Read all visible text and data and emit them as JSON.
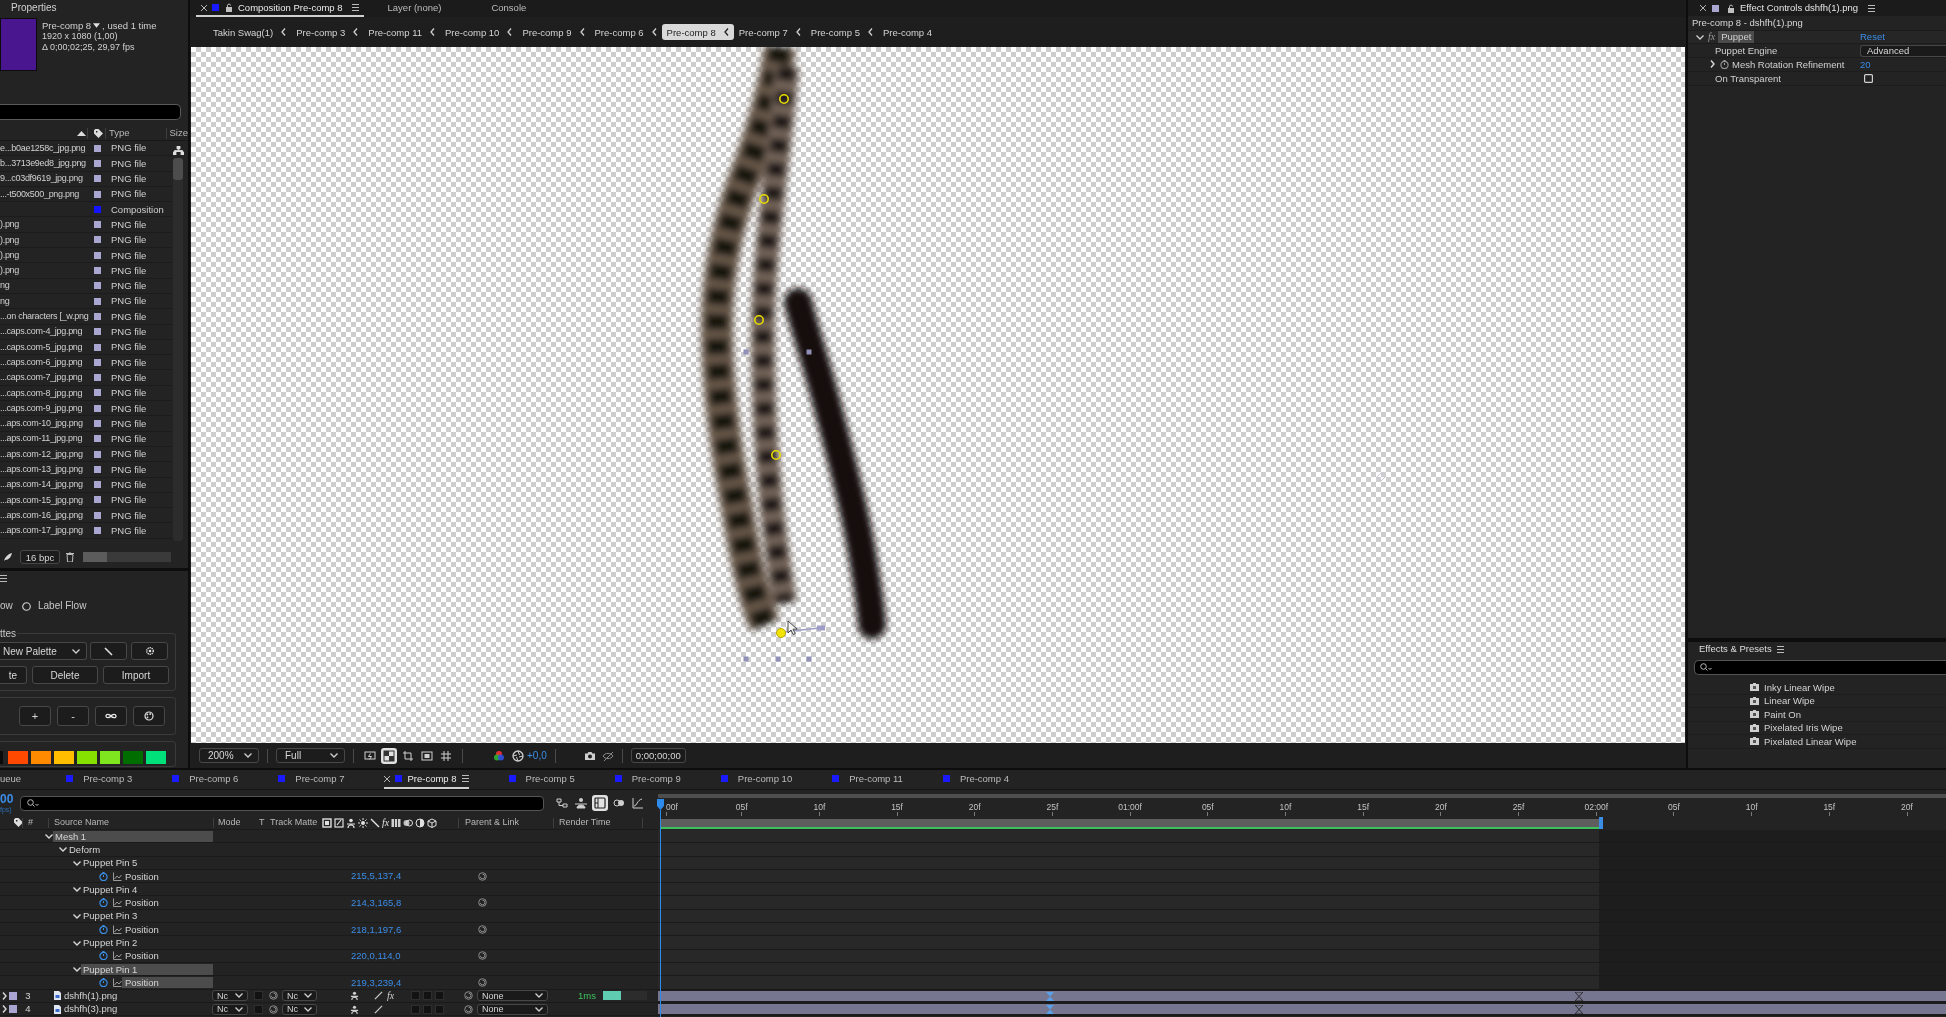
{
  "project_panel": {
    "tab": "Properties",
    "comp_name": "Pre-comp 8",
    "usage": ", used 1 time",
    "dimensions": "1920 x 1080 (1,00)",
    "duration": "Δ 0;00;02;25, 29,97 fps",
    "columns": [
      "Type",
      "Size"
    ],
    "items": [
      {
        "name": "e...b0ae1258c_jpg.png",
        "color": "#a9a7d1",
        "type": "PNG file"
      },
      {
        "name": "b...3713e9ed8_jpg.png",
        "color": "#a9a7d1",
        "type": "PNG file"
      },
      {
        "name": "9...c03df9619_jpg.png",
        "color": "#a9a7d1",
        "type": "PNG file"
      },
      {
        "name": "...-t500x500_png.png",
        "color": "#a9a7d1",
        "type": "PNG file"
      },
      {
        "color": "#1414ff",
        "type": "Composition"
      },
      {
        "name": ").png",
        "color": "#a9a7d1",
        "type": "PNG file"
      },
      {
        "name": ").png",
        "color": "#a9a7d1",
        "type": "PNG file"
      },
      {
        "name": ").png",
        "color": "#a9a7d1",
        "type": "PNG file"
      },
      {
        "name": ").png",
        "color": "#a9a7d1",
        "type": "PNG file"
      },
      {
        "name": "ng",
        "color": "#a9a7d1",
        "type": "PNG file"
      },
      {
        "name": "ng",
        "color": "#a9a7d1",
        "type": "PNG file"
      },
      {
        "name": "...on characters [_w.png",
        "color": "#a9a7d1",
        "type": "PNG file"
      },
      {
        "name": "...caps.com-4_jpg.png",
        "color": "#a9a7d1",
        "type": "PNG file"
      },
      {
        "name": "...caps.com-5_jpg.png",
        "color": "#a9a7d1",
        "type": "PNG file"
      },
      {
        "name": "...caps.com-6_jpg.png",
        "color": "#a9a7d1",
        "type": "PNG file"
      },
      {
        "name": "...caps.com-7_jpg.png",
        "color": "#a9a7d1",
        "type": "PNG file"
      },
      {
        "name": "...caps.com-8_jpg.png",
        "color": "#a9a7d1",
        "type": "PNG file"
      },
      {
        "name": "...caps.com-9_jpg.png",
        "color": "#a9a7d1",
        "type": "PNG file"
      },
      {
        "name": "...aps.com-10_jpg.png",
        "color": "#a9a7d1",
        "type": "PNG file"
      },
      {
        "name": "...aps.com-11_jpg.png",
        "color": "#a9a7d1",
        "type": "PNG file"
      },
      {
        "name": "...aps.com-12_jpg.png",
        "color": "#a9a7d1",
        "type": "PNG file"
      },
      {
        "name": "...aps.com-13_jpg.png",
        "color": "#a9a7d1",
        "type": "PNG file"
      },
      {
        "name": "...aps.com-14_jpg.png",
        "color": "#a9a7d1",
        "type": "PNG file"
      },
      {
        "name": "...aps.com-15_jpg.png",
        "color": "#a9a7d1",
        "type": "PNG file"
      },
      {
        "name": "...aps.com-16_jpg.png",
        "color": "#a9a7d1",
        "type": "PNG file"
      },
      {
        "name": "...aps.com-17_jpg.png",
        "color": "#a9a7d1",
        "type": "PNG file"
      }
    ],
    "bit_depth": "16 bpc"
  },
  "palette_panel": {
    "flow_label": "ow",
    "label_flow": {
      "label": "Label Flow",
      "selected": false
    },
    "palettes_title": "ttes",
    "palette": "New Palette",
    "buttons": [
      "te",
      "Delete",
      "Import"
    ],
    "step_buttons": [
      "+",
      "-"
    ],
    "swatches": [
      {
        "color": "#0a0a0a"
      },
      {
        "color": "#ff4800"
      },
      {
        "color": "#ff8a00"
      },
      {
        "color": "#ffbf00"
      },
      {
        "color": "#86e000"
      },
      {
        "color": "#7fe51f"
      },
      {
        "color": "#006d00"
      },
      {
        "color": "#00e07a"
      }
    ]
  },
  "composition_panel": {
    "tabs": [
      {
        "kind": "composition",
        "label": "Composition Pre-comp 8",
        "selected": true
      },
      {
        "kind": "plain",
        "label": "Layer (none)",
        "selected": false
      },
      {
        "kind": "plain",
        "label": "Console",
        "selected": false
      }
    ],
    "breadcrumbs": [
      {
        "label": "Takin Swag(1)",
        "selected": false
      },
      {
        "label": "Pre-comp 3",
        "selected": false
      },
      {
        "label": "Pre-comp 11",
        "selected": false
      },
      {
        "label": "Pre-comp 10",
        "selected": false
      },
      {
        "label": "Pre-comp 9",
        "selected": false
      },
      {
        "label": "Pre-comp 6",
        "selected": false
      },
      {
        "label": "Pre-comp 8",
        "selected": true
      },
      {
        "label": "Pre-comp 7",
        "selected": false
      },
      {
        "label": "Pre-comp 5",
        "selected": false
      },
      {
        "label": "Pre-comp 4",
        "selected": false
      }
    ],
    "zoom": "200%",
    "resolution": "Full",
    "toggles": [
      {
        "kind": "preview",
        "on": false
      },
      {
        "kind": "transparency",
        "on": true
      },
      {
        "kind": "region",
        "on": false
      },
      {
        "kind": "mask",
        "on": false
      },
      {
        "kind": "grid",
        "on": false
      }
    ],
    "exposure": "+0,0",
    "timecode": "0;00;00;00"
  },
  "effect_controls": {
    "tab_title": "Effect Controls dshfh(1).png",
    "subtitle": "Pre-comp 8 - dshfh(1).png",
    "effect": {
      "fx": "fx",
      "name": "Puppet",
      "reset": "Reset",
      "expanded": true,
      "selected": true
    },
    "properties": [
      {
        "kind": "dropdown",
        "label": "Puppet Engine",
        "value": "Advanced"
      },
      {
        "kind": "number",
        "label": "Mesh Rotation Refinement",
        "value": "20",
        "expanded": false
      },
      {
        "kind": "checkbox",
        "label": "On Transparent",
        "checked": false
      }
    ]
  },
  "effects_presets": {
    "title": "Effects & Presets",
    "items": [
      "Inky Linear Wipe",
      "Linear Wipe",
      "Paint On",
      "Pixelated Iris Wipe",
      "Pixelated Linear Wipe"
    ]
  },
  "timeline": {
    "tabs": [
      {
        "kind": "plain",
        "label": "ueue",
        "selected": false
      },
      {
        "kind": "comp",
        "label": "Pre-comp 3",
        "selected": false
      },
      {
        "kind": "comp",
        "label": "Pre-comp 6",
        "selected": false
      },
      {
        "kind": "comp",
        "label": "Pre-comp 7",
        "selected": false
      },
      {
        "kind": "comp",
        "label": "Pre-comp 8",
        "selected": true
      },
      {
        "kind": "comp",
        "label": "Pre-comp 5",
        "selected": false
      },
      {
        "kind": "comp",
        "label": "Pre-comp 9",
        "selected": false
      },
      {
        "kind": "comp",
        "label": "Pre-comp 10",
        "selected": false
      },
      {
        "kind": "comp",
        "label": "Pre-comp 11",
        "selected": false
      },
      {
        "kind": "comp",
        "label": "Pre-comp 4",
        "selected": false
      }
    ],
    "timecode": "00",
    "fps": "fps)",
    "switches": [
      {
        "kind": "flowchart",
        "on": false
      },
      {
        "kind": "shy",
        "on": false
      },
      {
        "kind": "blending",
        "on": true
      },
      {
        "kind": "motionblur",
        "on": false
      },
      {
        "kind": "graph",
        "on": false
      }
    ],
    "columns": {
      "number": "#",
      "source_name": "Source Name",
      "mode": "Mode",
      "t": "T",
      "track_matte": "Track Matte",
      "fx": "fx",
      "parent": "Parent & Link",
      "render_time": "Render Time"
    },
    "ruler": [
      "00f",
      "05f",
      "10f",
      "15f",
      "20f",
      "25f",
      "01:00f",
      "05f",
      "10f",
      "15f",
      "20f",
      "25f",
      "02:00f",
      "05f",
      "10f",
      "15f",
      "20f"
    ],
    "tree": [
      {
        "kind": "group",
        "name": "Mesh 1",
        "expanded": true,
        "selected": true,
        "children": [
          {
            "kind": "group",
            "name": "Deform",
            "expanded": true,
            "selected": false,
            "children": [
              {
                "kind": "group",
                "name": "Puppet Pin 5",
                "expanded": true,
                "selected": false,
                "children": [
                  {
                    "kind": "property",
                    "name": "Position",
                    "value": "215,5,137,4",
                    "selected": false
                  }
                ]
              },
              {
                "kind": "group",
                "name": "Puppet Pin 4",
                "expanded": true,
                "selected": false,
                "children": [
                  {
                    "kind": "property",
                    "name": "Position",
                    "value": "214,3,165,8",
                    "selected": false
                  }
                ]
              },
              {
                "kind": "group",
                "name": "Puppet Pin 3",
                "expanded": true,
                "selected": false,
                "children": [
                  {
                    "kind": "property",
                    "name": "Position",
                    "value": "218,1,197,6",
                    "selected": false
                  }
                ]
              },
              {
                "kind": "group",
                "name": "Puppet Pin 2",
                "expanded": true,
                "selected": false,
                "children": [
                  {
                    "kind": "property",
                    "name": "Position",
                    "value": "220,0,114,0",
                    "selected": false
                  }
                ]
              },
              {
                "kind": "group",
                "name": "Puppet Pin 1",
                "expanded": true,
                "selected": true,
                "children": [
                  {
                    "kind": "property",
                    "name": "Position",
                    "value": "219,3,239,4",
                    "selected": true
                  }
                ]
              }
            ]
          }
        ]
      }
    ],
    "layers": [
      {
        "number": "3",
        "name": "dshfh(1).png",
        "expanded": false,
        "mode": "Nc",
        "track_matte": "Nc",
        "effects": {
          "label": "fx",
          "on": true
        },
        "parent": "None",
        "render_time": "1ms",
        "level": 0.42
      },
      {
        "number": "4",
        "name": "dshfh(3).png",
        "expanded": false,
        "mode": "Nc",
        "track_matte": "Nc",
        "parent": "None"
      }
    ]
  }
}
